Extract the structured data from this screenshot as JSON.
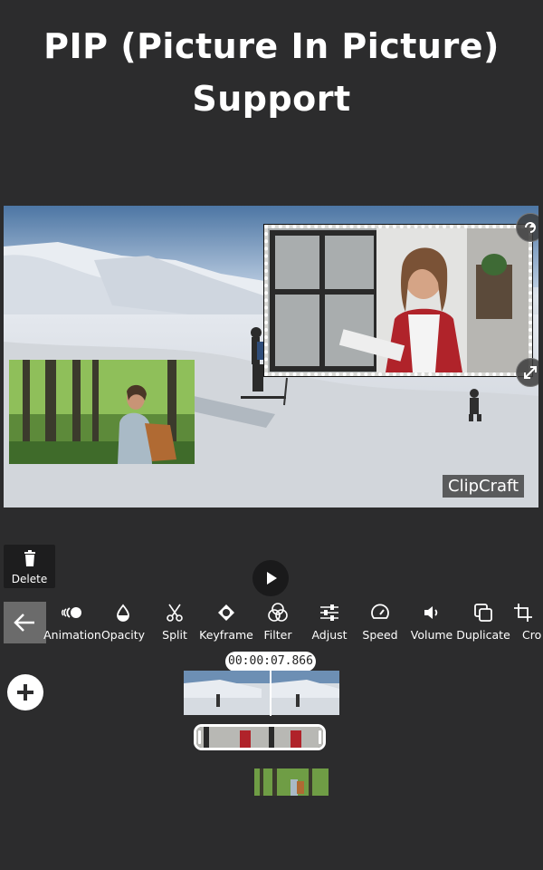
{
  "headline": {
    "line1": "PIP (Picture In Picture)",
    "line2": "Support"
  },
  "preview": {
    "watermark": "ClipCraft",
    "pip_layers": [
      "office-woman-clip",
      "forest-hiker-clip"
    ],
    "selection_style": "dotted-white"
  },
  "actions": {
    "delete_label": "Delete"
  },
  "toolbar": {
    "items": [
      {
        "label": "Animation",
        "icon": "animation-icon"
      },
      {
        "label": "Opacity",
        "icon": "opacity-drop-icon"
      },
      {
        "label": "Split",
        "icon": "scissors-icon"
      },
      {
        "label": "Keyframe",
        "icon": "keyframe-icon"
      },
      {
        "label": "Filter",
        "icon": "filter-circles-icon"
      },
      {
        "label": "Adjust",
        "icon": "sliders-icon"
      },
      {
        "label": "Speed",
        "icon": "speedometer-icon"
      },
      {
        "label": "Volume",
        "icon": "speaker-icon"
      },
      {
        "label": "Duplicate",
        "icon": "duplicate-icon"
      },
      {
        "label": "Cro",
        "icon": "crop-icon"
      }
    ]
  },
  "timeline": {
    "timecode": "00:00:07.866"
  },
  "colors": {
    "background": "#2c2c2d",
    "accent": "#ffffff",
    "back_button": "#6b6b6b"
  }
}
